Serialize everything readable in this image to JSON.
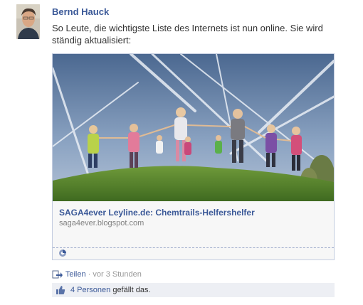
{
  "post": {
    "author": "Bernd Hauck",
    "message": "So Leute, die wichtigste Liste des Internets ist nun online. Sie wird ständig aktualisiert:",
    "attachment": {
      "title": "SAGA4ever Leyline.de: Chemtrails-Helfershelfer",
      "domain": "saga4ever.blogspot.com"
    },
    "actions": {
      "share_label": "Teilen",
      "separator": " · ",
      "timestamp": "vor 3 Stunden"
    },
    "likes": {
      "count_label": "4 Personen",
      "suffix": " gefällt das."
    }
  },
  "colors": {
    "link": "#3b5998",
    "likes_bg": "#edeff4",
    "muted": "#999999"
  },
  "icons": {
    "share": "share-icon",
    "like": "thumbs-up-icon",
    "loading": "loading-icon"
  }
}
